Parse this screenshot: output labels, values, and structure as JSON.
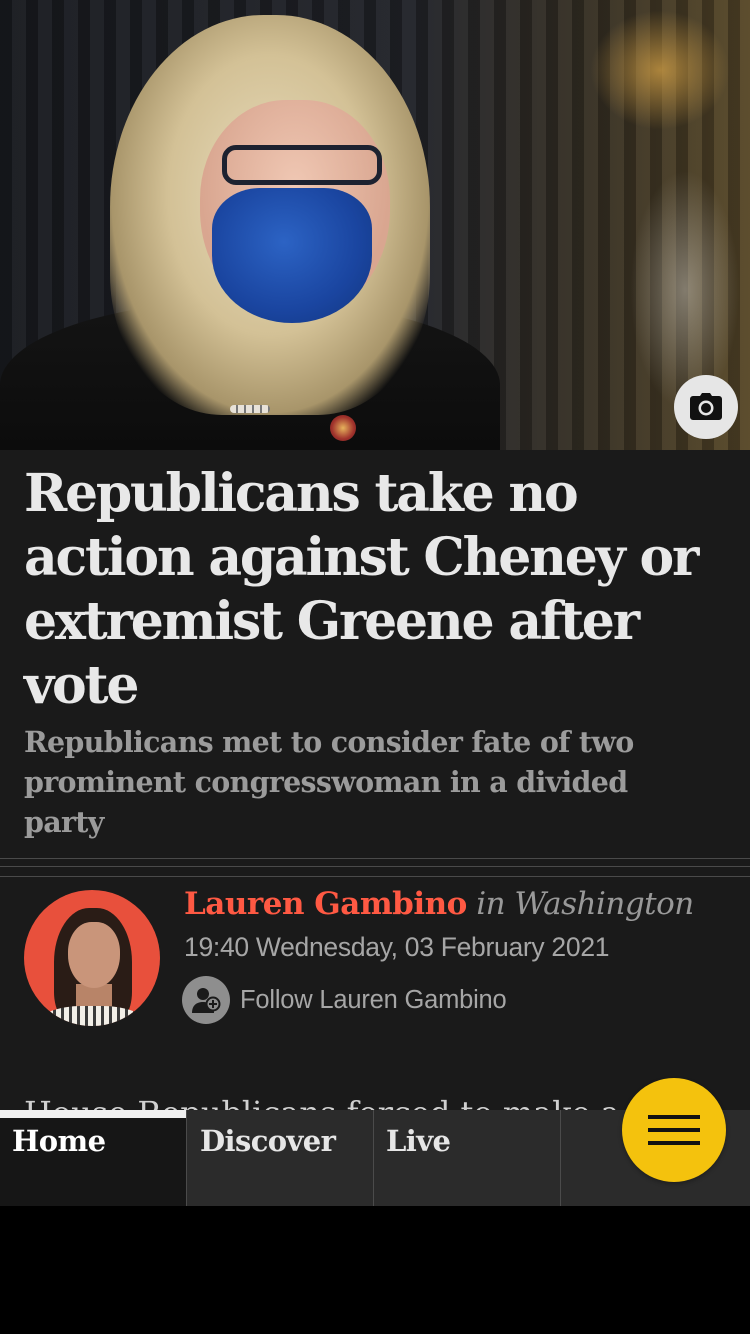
{
  "article": {
    "headline": "Republicans take no action against Cheney or extremist Greene after vote",
    "standfirst": "Republicans met to consider fate of two prominent congresswoman in a divided party",
    "byline": {
      "author": "Lauren Gambino",
      "location": "in Washington",
      "datetime": "19:40 Wednesday, 03 February 2021",
      "follow_label": "Follow Lauren Gambino"
    },
    "body_peek": "House Republicans forced to make a decision"
  },
  "hero": {
    "camera_icon": "camera-icon"
  },
  "nav": {
    "tabs": [
      {
        "label": "Home",
        "active": true
      },
      {
        "label": "Discover",
        "active": false
      },
      {
        "label": "Live",
        "active": false
      },
      {
        "label": "",
        "active": false
      }
    ],
    "menu_icon": "hamburger-menu-icon"
  },
  "colors": {
    "background": "#1a1a1a",
    "author_accent": "#ff5943",
    "menu_button": "#f4c20d",
    "nav_background": "#2b2b2b"
  }
}
